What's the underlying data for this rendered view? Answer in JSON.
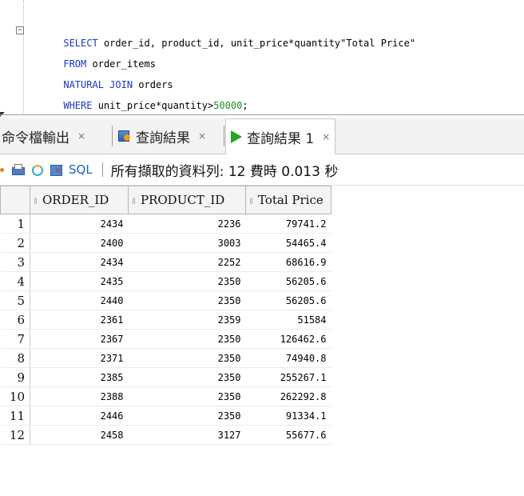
{
  "editor": {
    "lines": [
      {
        "segments": [
          {
            "text": "SELECT",
            "kind": "keyword"
          },
          {
            "text": " order_id, product_id, unit_price*quantity\"Total Price\"",
            "kind": "text"
          }
        ]
      },
      {
        "segments": [
          {
            "text": "FROM",
            "kind": "keyword"
          },
          {
            "text": " order_items",
            "kind": "text"
          }
        ]
      },
      {
        "segments": [
          {
            "text": "NATURAL JOIN",
            "kind": "keyword"
          },
          {
            "text": " orders",
            "kind": "text"
          }
        ]
      },
      {
        "segments": [
          {
            "text": "WHERE",
            "kind": "keyword"
          },
          {
            "text": " unit_price*quantity>",
            "kind": "text"
          },
          {
            "text": "50000",
            "kind": "number"
          },
          {
            "text": ";",
            "kind": "text"
          }
        ]
      }
    ],
    "fold_symbol": "−"
  },
  "tabs": {
    "script_output": {
      "label": "命令檔輸出",
      "close": "×"
    },
    "query_result": {
      "label": "查詢結果",
      "close": "×"
    },
    "query_result_1": {
      "label": "查詢結果 1",
      "close": "×"
    }
  },
  "toolbar": {
    "sql_label": "SQL",
    "separator": "|",
    "status": "所有擷取的資料列: 12 費時 0.013 秒"
  },
  "grid": {
    "columns": [
      "ORDER_ID",
      "PRODUCT_ID",
      "Total Price"
    ],
    "sort_glyph": "⇕",
    "rows": [
      {
        "n": "1",
        "order_id": "2434",
        "product_id": "2236",
        "total": "79741.2"
      },
      {
        "n": "2",
        "order_id": "2400",
        "product_id": "3003",
        "total": "54465.4"
      },
      {
        "n": "3",
        "order_id": "2434",
        "product_id": "2252",
        "total": "68616.9"
      },
      {
        "n": "4",
        "order_id": "2435",
        "product_id": "2350",
        "total": "56205.6"
      },
      {
        "n": "5",
        "order_id": "2440",
        "product_id": "2350",
        "total": "56205.6"
      },
      {
        "n": "6",
        "order_id": "2361",
        "product_id": "2359",
        "total": "51584"
      },
      {
        "n": "7",
        "order_id": "2367",
        "product_id": "2350",
        "total": "126462.6"
      },
      {
        "n": "8",
        "order_id": "2371",
        "product_id": "2350",
        "total": "74940.8"
      },
      {
        "n": "9",
        "order_id": "2385",
        "product_id": "2350",
        "total": "255267.1"
      },
      {
        "n": "10",
        "order_id": "2388",
        "product_id": "2350",
        "total": "262292.8"
      },
      {
        "n": "11",
        "order_id": "2446",
        "product_id": "2350",
        "total": "91334.1"
      },
      {
        "n": "12",
        "order_id": "2458",
        "product_id": "3127",
        "total": "55677.6"
      }
    ]
  },
  "colors": {
    "keyword": "#1d35c7",
    "number": "#1d8c2a",
    "link": "#1a62c9",
    "run_icon": "#27a327"
  },
  "icons": {
    "tab_results": "results-grid-icon",
    "tab_run": "run-triangle-icon",
    "toolbar": [
      "pin-icon",
      "printer-icon",
      "refresh-icon",
      "export-icon"
    ]
  }
}
